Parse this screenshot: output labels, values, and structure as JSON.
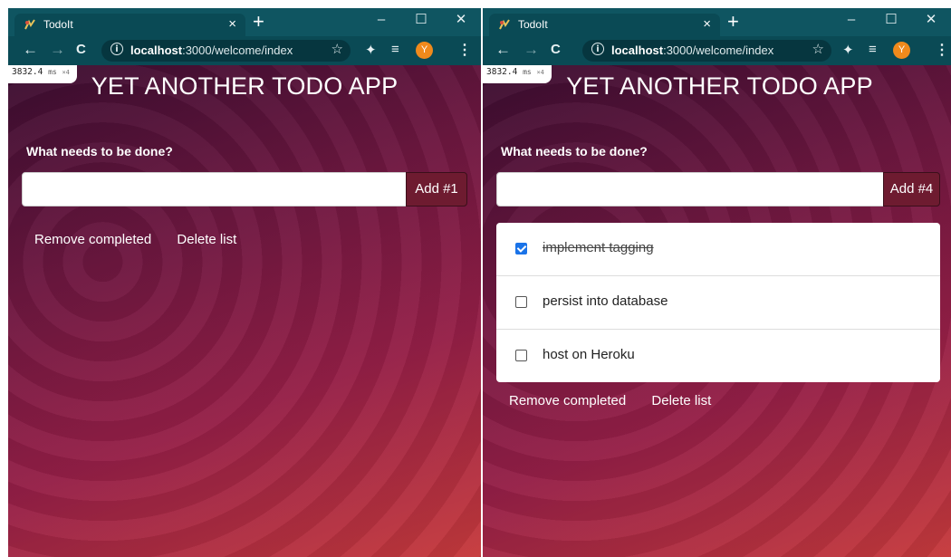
{
  "browser": {
    "tab_title": "TodoIt",
    "tab_close": "×",
    "new_tab": "+",
    "minimize": "–",
    "maximize": "☐",
    "close": "✕",
    "back": "←",
    "forward": "→",
    "reload": "C",
    "info": "i",
    "url_host": "localhost",
    "url_rest": ":3000/welcome/index",
    "star": "☆",
    "extensions": "✦",
    "reading_list": "≡",
    "avatar_letter": "Y",
    "menu": "⋮"
  },
  "perf": {
    "value": "3832.4",
    "unit": "ms",
    "multiplier": "×4"
  },
  "app": {
    "title": "YET ANOTHER TODO APP",
    "prompt": "What needs to be done?",
    "remove_completed": "Remove completed",
    "delete_list": "Delete list"
  },
  "left": {
    "add_label": "Add #1",
    "input_value": ""
  },
  "right": {
    "add_label": "Add #4",
    "input_value": "",
    "items": [
      {
        "label": "implement tagging",
        "done": true
      },
      {
        "label": "persist into database",
        "done": false
      },
      {
        "label": "host on Heroku",
        "done": false
      }
    ]
  },
  "colors": {
    "browser_frame": "#0f5561",
    "add_button": "#6e1b30",
    "checkbox_checked": "#1a73e8"
  }
}
